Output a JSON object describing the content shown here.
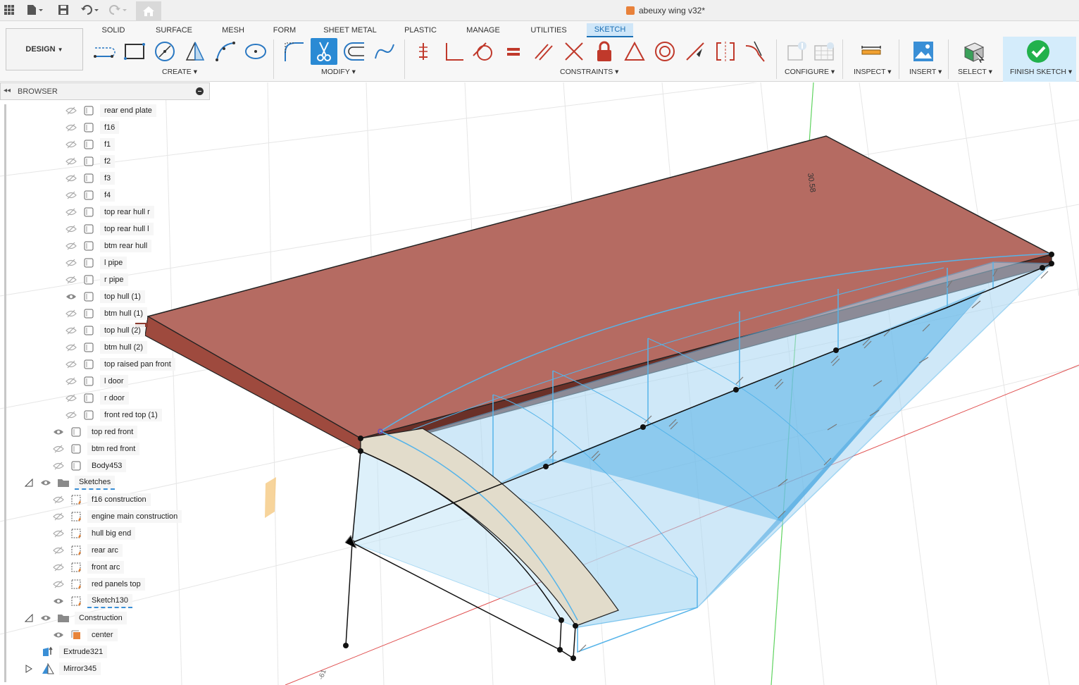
{
  "app": {
    "document_title": "abeuxy wing v32*",
    "workspace_button": "DESIGN"
  },
  "tabs": [
    {
      "label": "SOLID"
    },
    {
      "label": "SURFACE"
    },
    {
      "label": "MESH"
    },
    {
      "label": "FORM"
    },
    {
      "label": "SHEET METAL"
    },
    {
      "label": "PLASTIC"
    },
    {
      "label": "MANAGE"
    },
    {
      "label": "UTILITIES"
    },
    {
      "label": "SKETCH"
    }
  ],
  "active_tab": "SKETCH",
  "groups": {
    "create": "CREATE",
    "modify": "MODIFY",
    "constraints": "CONSTRAINTS",
    "configure": "CONFIGURE",
    "inspect": "INSPECT",
    "insert": "INSERT",
    "select": "SELECT",
    "finish": "FINISH SKETCH"
  },
  "browser": {
    "title": "BROWSER",
    "bodies": [
      {
        "label": "rear end plate",
        "visible": false
      },
      {
        "label": "f16",
        "visible": false
      },
      {
        "label": "f1",
        "visible": false
      },
      {
        "label": "f2",
        "visible": false
      },
      {
        "label": "f3",
        "visible": false
      },
      {
        "label": "f4",
        "visible": false
      },
      {
        "label": "top rear hull r",
        "visible": false
      },
      {
        "label": "top rear hull l",
        "visible": false
      },
      {
        "label": "btm rear hull",
        "visible": false
      },
      {
        "label": "l pipe",
        "visible": false
      },
      {
        "label": "r pipe",
        "visible": false
      },
      {
        "label": "top hull (1)",
        "visible": true
      },
      {
        "label": "btm hull (1)",
        "visible": false
      },
      {
        "label": "top hull (2)",
        "visible": false
      },
      {
        "label": "btm hull (2)",
        "visible": false
      },
      {
        "label": "top raised pan front",
        "visible": false
      },
      {
        "label": "l door",
        "visible": false
      },
      {
        "label": "r door",
        "visible": false
      },
      {
        "label": "front red top (1)",
        "visible": false
      }
    ],
    "outer_bodies": [
      {
        "label": "top red front",
        "visible": true
      },
      {
        "label": "btm red front",
        "visible": false
      },
      {
        "label": "Body453",
        "visible": false
      }
    ],
    "sketches_folder": "Sketches",
    "sketches": [
      {
        "label": "f16 construction",
        "visible": false
      },
      {
        "label": "engine main construction",
        "visible": false
      },
      {
        "label": "hull big end",
        "visible": false
      },
      {
        "label": "rear arc",
        "visible": false
      },
      {
        "label": "front arc",
        "visible": false
      },
      {
        "label": "red panels top",
        "visible": false
      },
      {
        "label": "Sketch130",
        "visible": true
      }
    ],
    "construction_folder": "Construction",
    "construction": [
      {
        "label": "center",
        "visible": true
      }
    ],
    "features": [
      {
        "label": "Extrude321"
      },
      {
        "label": "Mirror345"
      }
    ]
  },
  "viewport": {
    "dimension_text": "30.58",
    "axis_label_bottom": "-61"
  },
  "colors": {
    "accent": "#1a6fb5",
    "red_panel": "#b8695f",
    "sketch_blue": "#56b4e9",
    "finish_green": "#22b14c"
  }
}
